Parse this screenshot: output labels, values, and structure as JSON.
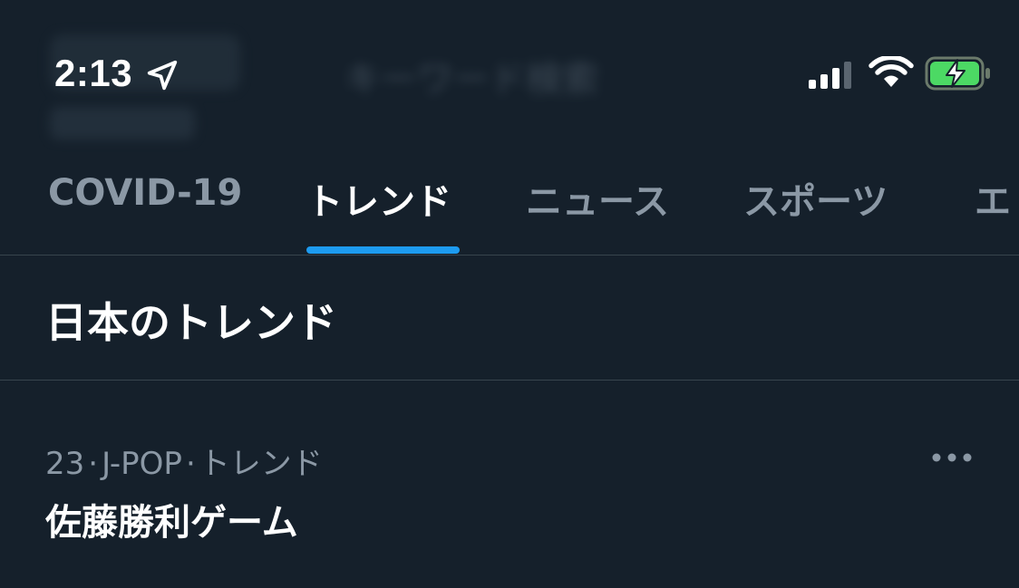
{
  "status_bar": {
    "time": "2:13",
    "icons": [
      "location-arrow-icon",
      "cellular-signal-icon",
      "wifi-icon",
      "battery-charging-icon"
    ],
    "battery_color": "#4cd964"
  },
  "background_blur": {
    "search_text": "キーワード検索"
  },
  "tabs": [
    {
      "label": "COVID-19",
      "active": false
    },
    {
      "label": "トレンド",
      "active": true
    },
    {
      "label": "ニュース",
      "active": false
    },
    {
      "label": "スポーツ",
      "active": false
    },
    {
      "label": "エ",
      "active": false
    }
  ],
  "accent_color": "#1d9bf0",
  "section": {
    "title": "日本のトレンド"
  },
  "trends": [
    {
      "rank": "23",
      "category": "J-POP",
      "context": "トレンド",
      "title": "佐藤勝利ゲーム",
      "more_icon": "more-horizontal-icon"
    }
  ]
}
